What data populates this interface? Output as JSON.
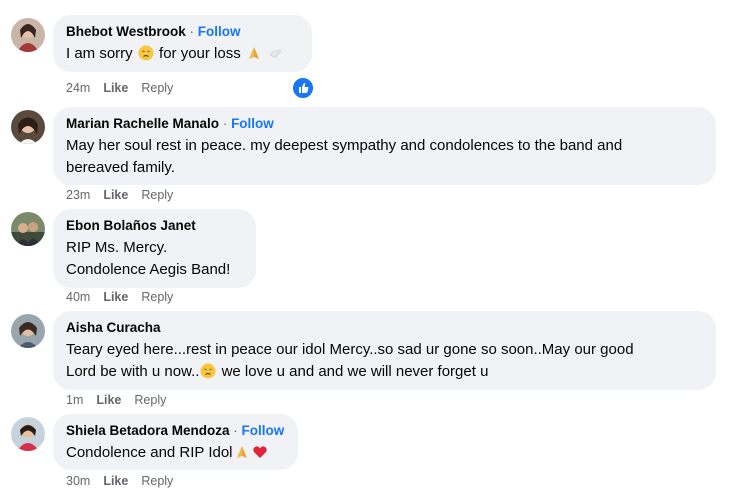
{
  "comments": [
    {
      "author": "Bhebot Westbrook",
      "follow": "Follow",
      "lines": [
        "I am sorry",
        "for your loss"
      ],
      "time": "24m",
      "like": "Like",
      "reply": "Reply"
    },
    {
      "author": "Marian Rachelle Manalo",
      "follow": "Follow",
      "lines": [
        "May her soul rest in peace. my deepest sympathy and condolences to the band and",
        "bereaved family."
      ],
      "time": "23m",
      "like": "Like",
      "reply": "Reply"
    },
    {
      "author": "Ebon Bolaños Janet",
      "follow": "",
      "lines": [
        "RIP Ms. Mercy.",
        "Condolence Aegis Band!"
      ],
      "time": "40m",
      "like": "Like",
      "reply": "Reply"
    },
    {
      "author": "Aisha Curacha",
      "follow": "",
      "lines": [
        "Teary eyed here...rest in peace our idol Mercy..so sad ur gone so soon..May our good",
        "Lord be with u now..",
        "we love u and and we will never forget u"
      ],
      "time": "1m",
      "like": "Like",
      "reply": "Reply"
    },
    {
      "author": "Shiela Betadora Mendoza",
      "follow": "Follow",
      "lines": [
        "Condolence and RIP Idol"
      ],
      "time": "30m",
      "like": "Like",
      "reply": "Reply"
    }
  ],
  "colors": {
    "bubble": "#f0f2f5",
    "link": "#1877f2",
    "meta": "#65676b"
  },
  "icons": [
    "like-reaction-icon",
    "sad-face-icon",
    "praying-hands-icon",
    "red-heart-icon"
  ]
}
